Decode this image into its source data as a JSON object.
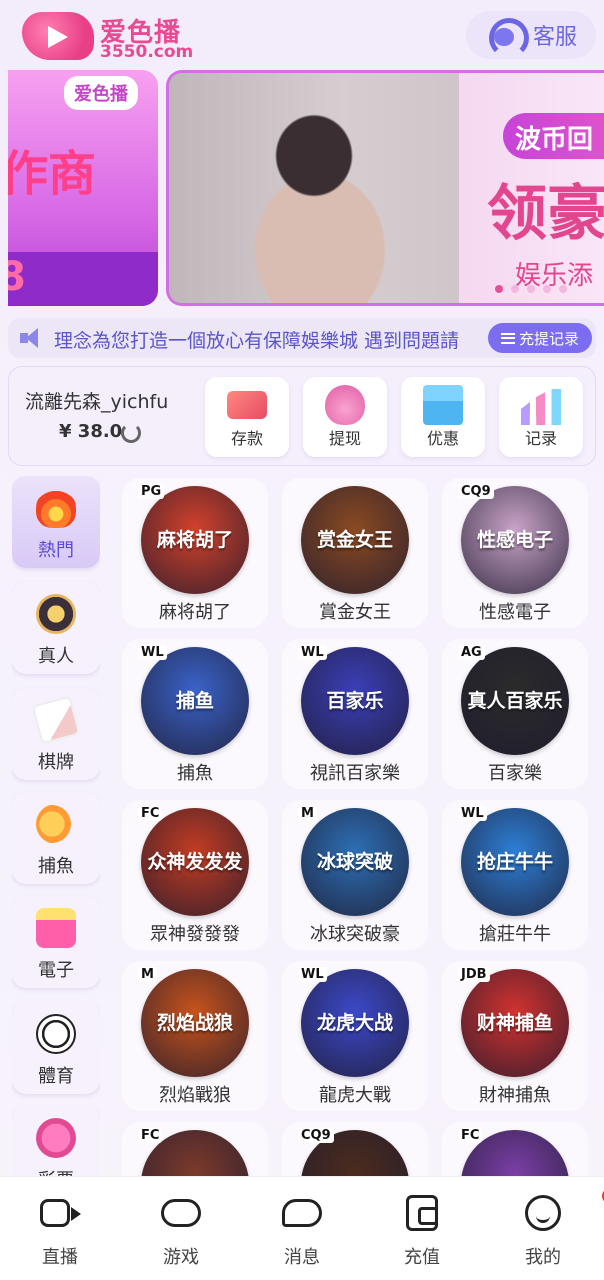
{
  "header": {
    "logo_name": "爱色播",
    "logo_domain": "3550.com",
    "service_label": "客服"
  },
  "banner": {
    "left_badge": "爱色播",
    "left_big": "作商",
    "left_num": "8",
    "tag": "波币回",
    "big": "领豪",
    "sub": "娱乐添"
  },
  "notice": {
    "text": "理念為您打造一個放心有保障娛樂城  遇到問題請",
    "record_button": "充提记录"
  },
  "wallet": {
    "username": "流離先森_yichfu",
    "balance": "¥ 38.0",
    "actions": [
      {
        "label": "存款",
        "icon": "card-icon"
      },
      {
        "label": "提现",
        "icon": "moneybag-icon"
      },
      {
        "label": "优惠",
        "icon": "gift-icon"
      },
      {
        "label": "记录",
        "icon": "chart-icon"
      }
    ]
  },
  "categories": [
    {
      "label": "熱門",
      "icon": "fire-icon",
      "active": true
    },
    {
      "label": "真人",
      "icon": "chip-icon"
    },
    {
      "label": "棋牌",
      "icon": "cards-icon"
    },
    {
      "label": "捕魚",
      "icon": "fish-icon"
    },
    {
      "label": "電子",
      "icon": "slot-icon"
    },
    {
      "label": "體育",
      "icon": "soccer-ball-icon"
    },
    {
      "label": "彩票",
      "icon": "lottery-icon"
    }
  ],
  "games": [
    {
      "label": "麻将胡了",
      "brand": "PG",
      "icon_text": "麻将胡了",
      "color": "#d3412b"
    },
    {
      "label": "賞金女王",
      "brand": "",
      "icon_text": "赏金女王",
      "color": "#8b4a22"
    },
    {
      "label": "性感電子",
      "brand": "CQ9",
      "icon_text": "性感电子",
      "color": "#c9a3c8"
    },
    {
      "label": "捕魚",
      "brand": "WL",
      "icon_text": "捕鱼",
      "color": "#3a63c9"
    },
    {
      "label": "視訊百家樂",
      "brand": "WL",
      "icon_text": "百家乐",
      "color": "#3b3fb8"
    },
    {
      "label": "百家樂",
      "brand": "AG",
      "icon_text": "真人百家乐",
      "color": "#2b2b2b"
    },
    {
      "label": "眾神發發發",
      "brand": "FC",
      "icon_text": "众神发发发",
      "color": "#c33c22"
    },
    {
      "label": "冰球突破豪",
      "brand": "M",
      "icon_text": "冰球突破",
      "color": "#2d6fb5"
    },
    {
      "label": "搶莊牛牛",
      "brand": "WL",
      "icon_text": "抢庄牛牛",
      "color": "#2d7fd6"
    },
    {
      "label": "烈焰戰狼",
      "brand": "M",
      "icon_text": "烈焰战狼",
      "color": "#c8531c"
    },
    {
      "label": "龍虎大戰",
      "brand": "WL",
      "icon_text": "龙虎大战",
      "color": "#3c49c9"
    },
    {
      "label": "財神捕魚",
      "brand": "JDB",
      "icon_text": "财神捕鱼",
      "color": "#d2322f"
    },
    {
      "label": "",
      "brand": "FC",
      "icon_text": "",
      "color": "#7d3a2c"
    },
    {
      "label": "",
      "brand": "CQ9",
      "icon_text": "",
      "color": "#4b2c1e"
    },
    {
      "label": "",
      "brand": "FC",
      "icon_text": "",
      "color": "#7a3fa6"
    }
  ],
  "tabbar": [
    {
      "label": "直播",
      "icon": "video-camera-icon"
    },
    {
      "label": "游戏",
      "icon": "gamepad-icon"
    },
    {
      "label": "消息",
      "icon": "message-icon"
    },
    {
      "label": "充值",
      "icon": "wallet-icon"
    },
    {
      "label": "我的",
      "icon": "profile-icon",
      "badge": true
    }
  ]
}
